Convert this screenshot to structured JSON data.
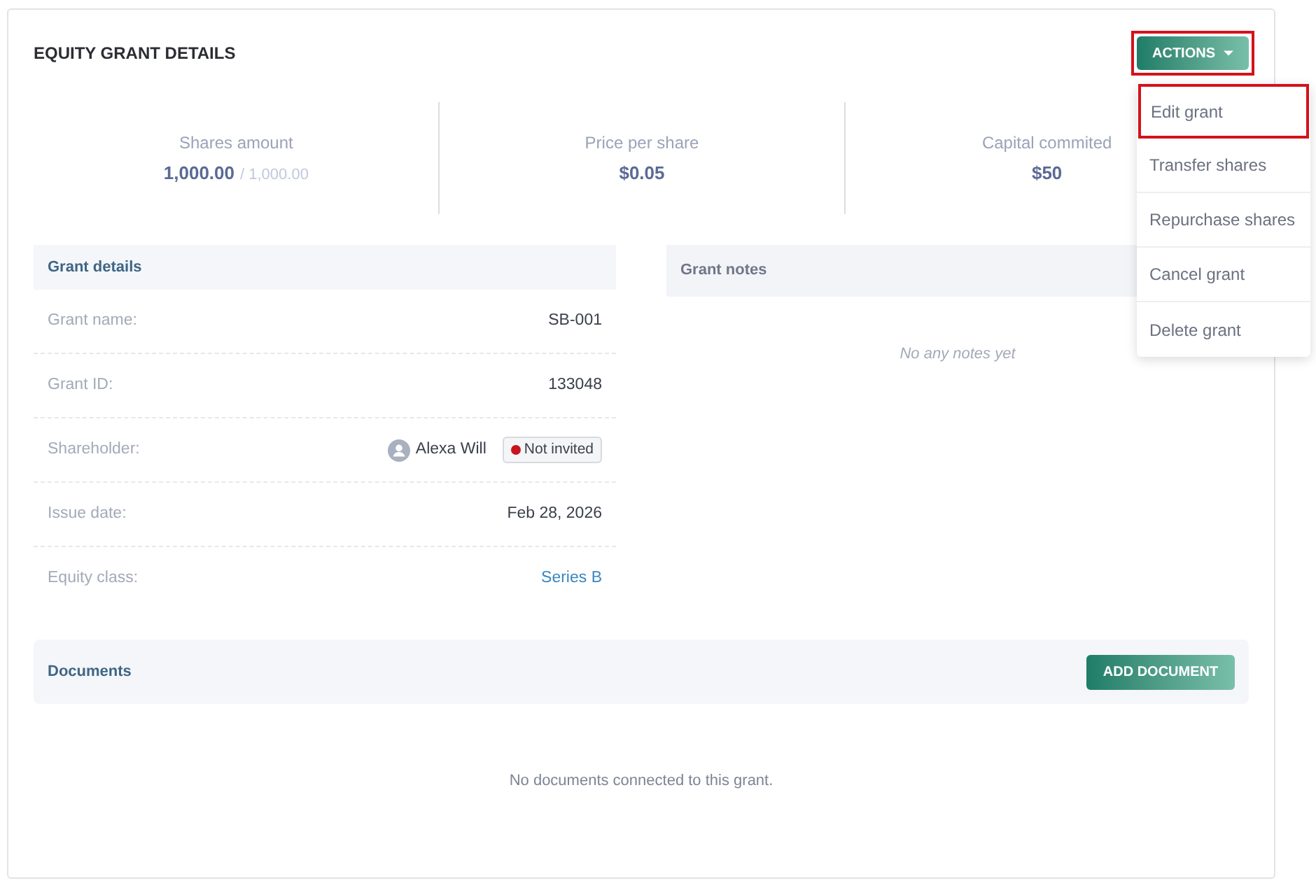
{
  "header": {
    "title": "EQUITY GRANT DETAILS",
    "actions_button": {
      "label": "ACTIONS",
      "highlighted": true
    }
  },
  "actions_menu": {
    "expanded": true,
    "items": [
      {
        "label": "Edit grant",
        "highlighted": true
      },
      {
        "label": "Transfer shares",
        "highlighted": false
      },
      {
        "label": "Repurchase shares",
        "highlighted": false
      },
      {
        "label": "Cancel grant",
        "highlighted": false
      },
      {
        "label": "Delete grant",
        "highlighted": false
      }
    ]
  },
  "stats": [
    {
      "label": "Shares amount",
      "value": "1,000.00",
      "total": "/ 1,000.00"
    },
    {
      "label": "Price per share",
      "value": "$0.05"
    },
    {
      "label": "Capital commited",
      "value": "$50"
    }
  ],
  "grant_details": {
    "title": "Grant details",
    "rows": [
      {
        "kind": "text",
        "label": "Grant name:",
        "value": "SB-001"
      },
      {
        "kind": "text",
        "label": "Grant ID:",
        "value": "133048"
      },
      {
        "kind": "person",
        "label": "Shareholder:",
        "value": "Alexa Will",
        "badge": {
          "label": "Not invited",
          "color": "#c8141e"
        }
      },
      {
        "kind": "text",
        "label": "Issue date:",
        "value": "Feb 28, 2026"
      },
      {
        "kind": "link",
        "label": "Equity class:",
        "value": "Series B"
      }
    ]
  },
  "grant_notes": {
    "title": "Grant notes",
    "empty_text": "No any notes yet"
  },
  "documents": {
    "title": "Documents",
    "button": "ADD DOCUMENT",
    "empty_text": "No documents connected to this grant."
  }
}
